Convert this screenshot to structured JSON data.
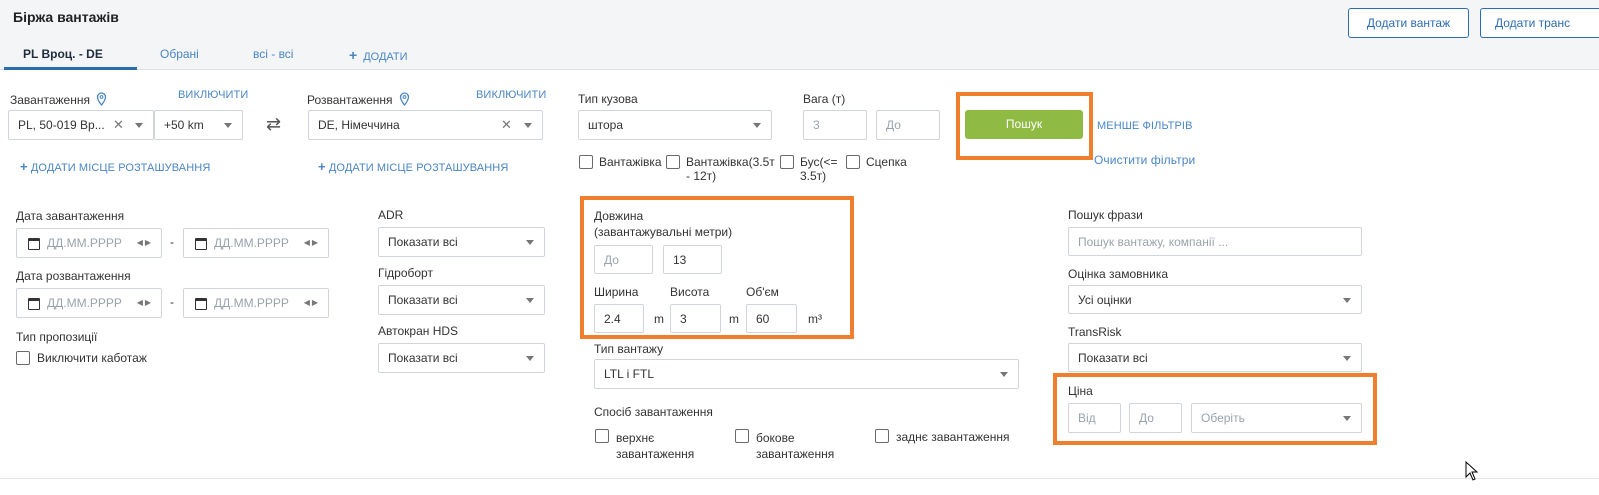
{
  "header": {
    "title": "Біржа вантажів",
    "add_cargo": "Додати вантаж",
    "add_transport": "Додати транс"
  },
  "tabs": [
    "PL Вроц. - DE",
    "Обрані",
    "всі - всі",
    "ДОДАТИ"
  ],
  "loading": {
    "label": "Завантаження",
    "exclude": "ВИКЛЮЧИТИ",
    "value": "PL, 50-019 Вр...",
    "radius": "+50 km",
    "add_location": "ДОДАТИ МІСЦЕ РОЗТАШУВАННЯ"
  },
  "unloading": {
    "label": "Розвантаження",
    "exclude": "ВИКЛЮЧИТИ",
    "value": "DE,  Німеччина",
    "add_location": "ДОДАТИ МІСЦЕ РОЗТАШУВАННЯ"
  },
  "body_type": {
    "label": "Тип кузова",
    "value": "штора"
  },
  "weight": {
    "label": "Вага (т)",
    "from": "3",
    "to_placeholder": "До"
  },
  "search_button": "Пошук",
  "less_filters": "МЕНШЕ ФІЛЬТРІВ",
  "clear_filters": "Очистити фільтри",
  "vehicle_types": {
    "truck": "Вантажівка",
    "truck_mid_1": "Вантажівка(3.5т",
    "truck_mid_2": "- 12т)",
    "bus_1": "Бус(<=",
    "bus_2": "3.5т)",
    "trailer": "Сцепка"
  },
  "dates": {
    "loading_label": "Дата завантаження",
    "unloading_label": "Дата розвантаження",
    "placeholder": "ДД.ММ.РРРР",
    "dash": "-"
  },
  "offer_type": {
    "label": "Тип пропозиції",
    "cabotage": "Виключити каботаж"
  },
  "adr": {
    "label": "ADR",
    "value": "Показати всі"
  },
  "tail_lift": {
    "label": "Гідроборт",
    "value": "Показати всі"
  },
  "crane": {
    "label": "Автокран HDS",
    "value": "Показати всі"
  },
  "length": {
    "label": "Довжина",
    "sublabel": "(завантажувальні метри)",
    "from_placeholder": "До",
    "to": "13"
  },
  "width": {
    "label": "Ширина",
    "value": "2.4",
    "unit": "m"
  },
  "height": {
    "label": "Висота",
    "value": "3",
    "unit": "m"
  },
  "volume": {
    "label": "Об'єм",
    "value": "60",
    "unit": "m³"
  },
  "cargo_type": {
    "label": "Тип вантажу",
    "value": "LTL і FTL"
  },
  "loading_method": {
    "label": "Спосіб завантаження",
    "top_1": "верхнє",
    "top_2": "завантаження",
    "side_1": "бокове",
    "side_2": "завантаження",
    "rear": "заднє завантаження"
  },
  "phrase_search": {
    "label": "Пошук фрази",
    "placeholder": "Пошук вантажу, компанії ..."
  },
  "customer_rating": {
    "label": "Оцінка замовника",
    "value": "Усі оцінки"
  },
  "transrisk": {
    "label": "TransRisk",
    "value": "Показати всі"
  },
  "price": {
    "label": "Ціна",
    "from": "Від",
    "to": "До",
    "select": "Оберіть"
  },
  "colors": {
    "accent": "#2c6db1",
    "search_green": "#8fbb45",
    "highlight": "#f07f2d"
  }
}
